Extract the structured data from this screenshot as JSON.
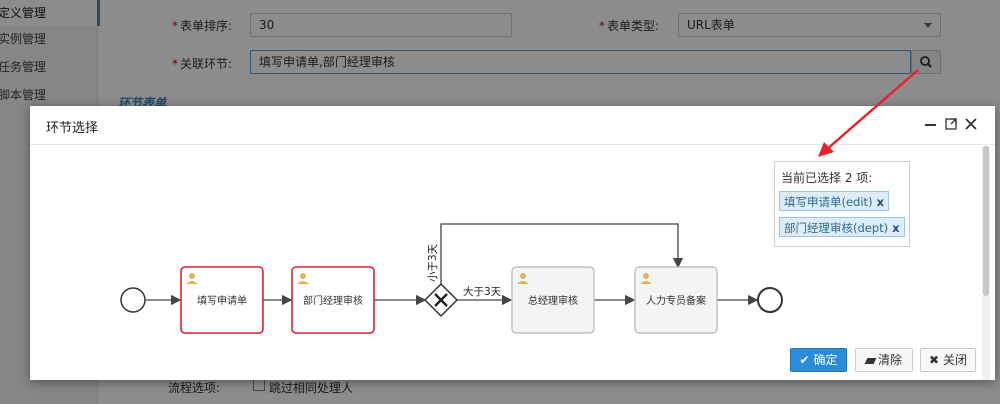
{
  "sidebar": {
    "items": [
      {
        "label": "定义管理"
      },
      {
        "label": "实例管理"
      },
      {
        "label": "任务管理"
      },
      {
        "label": "脚本管理"
      }
    ]
  },
  "form": {
    "sort_label": "表单排序:",
    "sort_value": "30",
    "type_label": "表单类型:",
    "type_value": "URL表单",
    "node_label": "关联环节:",
    "node_value": "填写申请单,部门经理审核",
    "section_title": "环节表单",
    "options_label": "流程选项:",
    "options_checkbox": "跳过相同处理人"
  },
  "modal": {
    "title": "环节选择",
    "selection": {
      "title": "当前已选择 2 项:",
      "tags": [
        {
          "label": "填写申请单(edit)",
          "remove": "x"
        },
        {
          "label": "部门经理审核(dept)",
          "remove": "x"
        }
      ]
    },
    "diagram": {
      "nodes": [
        {
          "label": "填写申请单",
          "selected": true
        },
        {
          "label": "部门经理审核",
          "selected": true
        },
        {
          "label": "总经理审核",
          "selected": false
        },
        {
          "label": "人力专员备案",
          "selected": false
        }
      ],
      "edge_labels": {
        "less": "小于3天",
        "greater": "大于3天"
      }
    },
    "buttons": {
      "ok": "确定",
      "clear": "清除",
      "close": "关闭"
    }
  },
  "colors": {
    "accent": "#2d8cd9",
    "selected_border": "#d9232d",
    "annotation_arrow": "#e8212b",
    "tag_bg": "#ddecf6"
  }
}
